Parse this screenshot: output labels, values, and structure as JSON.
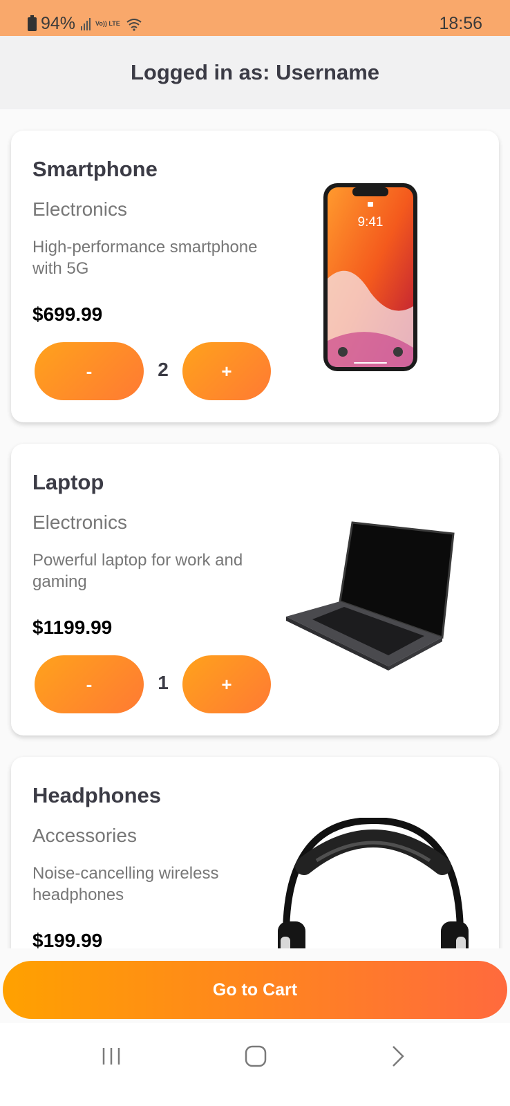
{
  "status_bar": {
    "battery": "94%",
    "network": "Vo)) LTE",
    "time": "18:56",
    "icons": [
      "battery-icon",
      "signal-icon",
      "volte-icon",
      "wifi-icon"
    ]
  },
  "header": {
    "title": "Logged in as: Username"
  },
  "products": [
    {
      "name": "Smartphone",
      "category": "Electronics",
      "description": "High-performance smartphone with 5G",
      "price": "$699.99",
      "quantity": "2",
      "minus_label": "-",
      "plus_label": "+",
      "screen_time": "9:41",
      "image": "smartphone-image"
    },
    {
      "name": "Laptop",
      "category": "Electronics",
      "description": "Powerful laptop for work and gaming",
      "price": "$1199.99",
      "quantity": "1",
      "minus_label": "-",
      "plus_label": "+",
      "image": "laptop-image"
    },
    {
      "name": "Headphones",
      "category": "Accessories",
      "description": "Noise-cancelling wireless headphones",
      "price": "$199.99",
      "image": "headphones-image"
    }
  ],
  "cart_button": {
    "label": "Go to Cart"
  },
  "nav": {
    "icons": [
      "recent-apps-icon",
      "home-icon",
      "back-icon"
    ]
  },
  "colors": {
    "status_bar": "#f9a86b",
    "accent_start": "#ffa21c",
    "accent_end": "#ff6a3d",
    "text_dark": "#3b3b45"
  }
}
